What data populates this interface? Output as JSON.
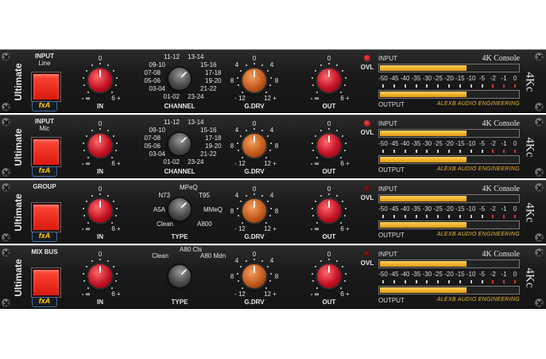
{
  "plugin": {
    "brand": "Ultimate",
    "logo_text": "fxA",
    "model_title": "4K Console",
    "side_title": "4Kc",
    "manufacturer": "ALEXB AUDIO ENGINEERING",
    "meter_scale": [
      "-50",
      "-45",
      "-40",
      "-35",
      "-30",
      "-25",
      "-20",
      "-15",
      "-10",
      "-5",
      "-2",
      "-1",
      "0"
    ],
    "meter_labels": {
      "input": "INPUT",
      "output": "OUTPUT"
    },
    "ovl_label": "OVL",
    "in_knob": {
      "label": "IN",
      "top": "0",
      "left": "- ∞",
      "right": "6 +"
    },
    "gdrv_knob": {
      "label": "G.DRV",
      "top": "0",
      "tl": "4",
      "tr": "4",
      "ml": "8",
      "mr": "8",
      "left": "- 12",
      "right": "12 +"
    },
    "out_knob": {
      "label": "OUT",
      "top": "0",
      "left": "- ∞",
      "right": "6 +"
    },
    "colors": {
      "accent_red": "#e8271a",
      "meter_fill": "#f0b429",
      "knob_red": "#c21224",
      "knob_orange": "#c35a1c"
    }
  },
  "strips": [
    {
      "button_label": "INPUT",
      "button_sub": "Line",
      "selector_label": "CHANNEL",
      "selector_options": [
        "11-12",
        "13-14",
        "09-10",
        "15-16",
        "07-08",
        "17-18",
        "05-06",
        "19-20",
        "03-04",
        "21-22",
        "01-02",
        "23-24"
      ],
      "ovl_on": true,
      "input_level": 0.62,
      "output_level": 0.62
    },
    {
      "button_label": "INPUT",
      "button_sub": "Mic",
      "selector_label": "CHANNEL",
      "selector_options": [
        "11-12",
        "13-14",
        "09-10",
        "15-16",
        "07-08",
        "17-18",
        "05-06",
        "19-20",
        "03-04",
        "21-22",
        "01-02",
        "23-24"
      ],
      "ovl_on": true,
      "input_level": 0.62,
      "output_level": 0.62
    },
    {
      "button_label": "GROUP",
      "button_sub": "",
      "selector_label": "TYPE",
      "selector_options": [
        "MPeQ",
        "N73",
        "T95",
        "A5A",
        "MMeQ",
        "Clean",
        "A800"
      ],
      "ovl_on": false,
      "input_level": 0.62,
      "output_level": 0.62
    },
    {
      "button_label": "MIX BUS",
      "button_sub": "",
      "selector_label": "TYPE",
      "selector_options": [
        "A80 Cls",
        "Clean",
        "A80 Mdn"
      ],
      "ovl_on": false,
      "input_level": 0.62,
      "output_level": 0.62
    }
  ]
}
